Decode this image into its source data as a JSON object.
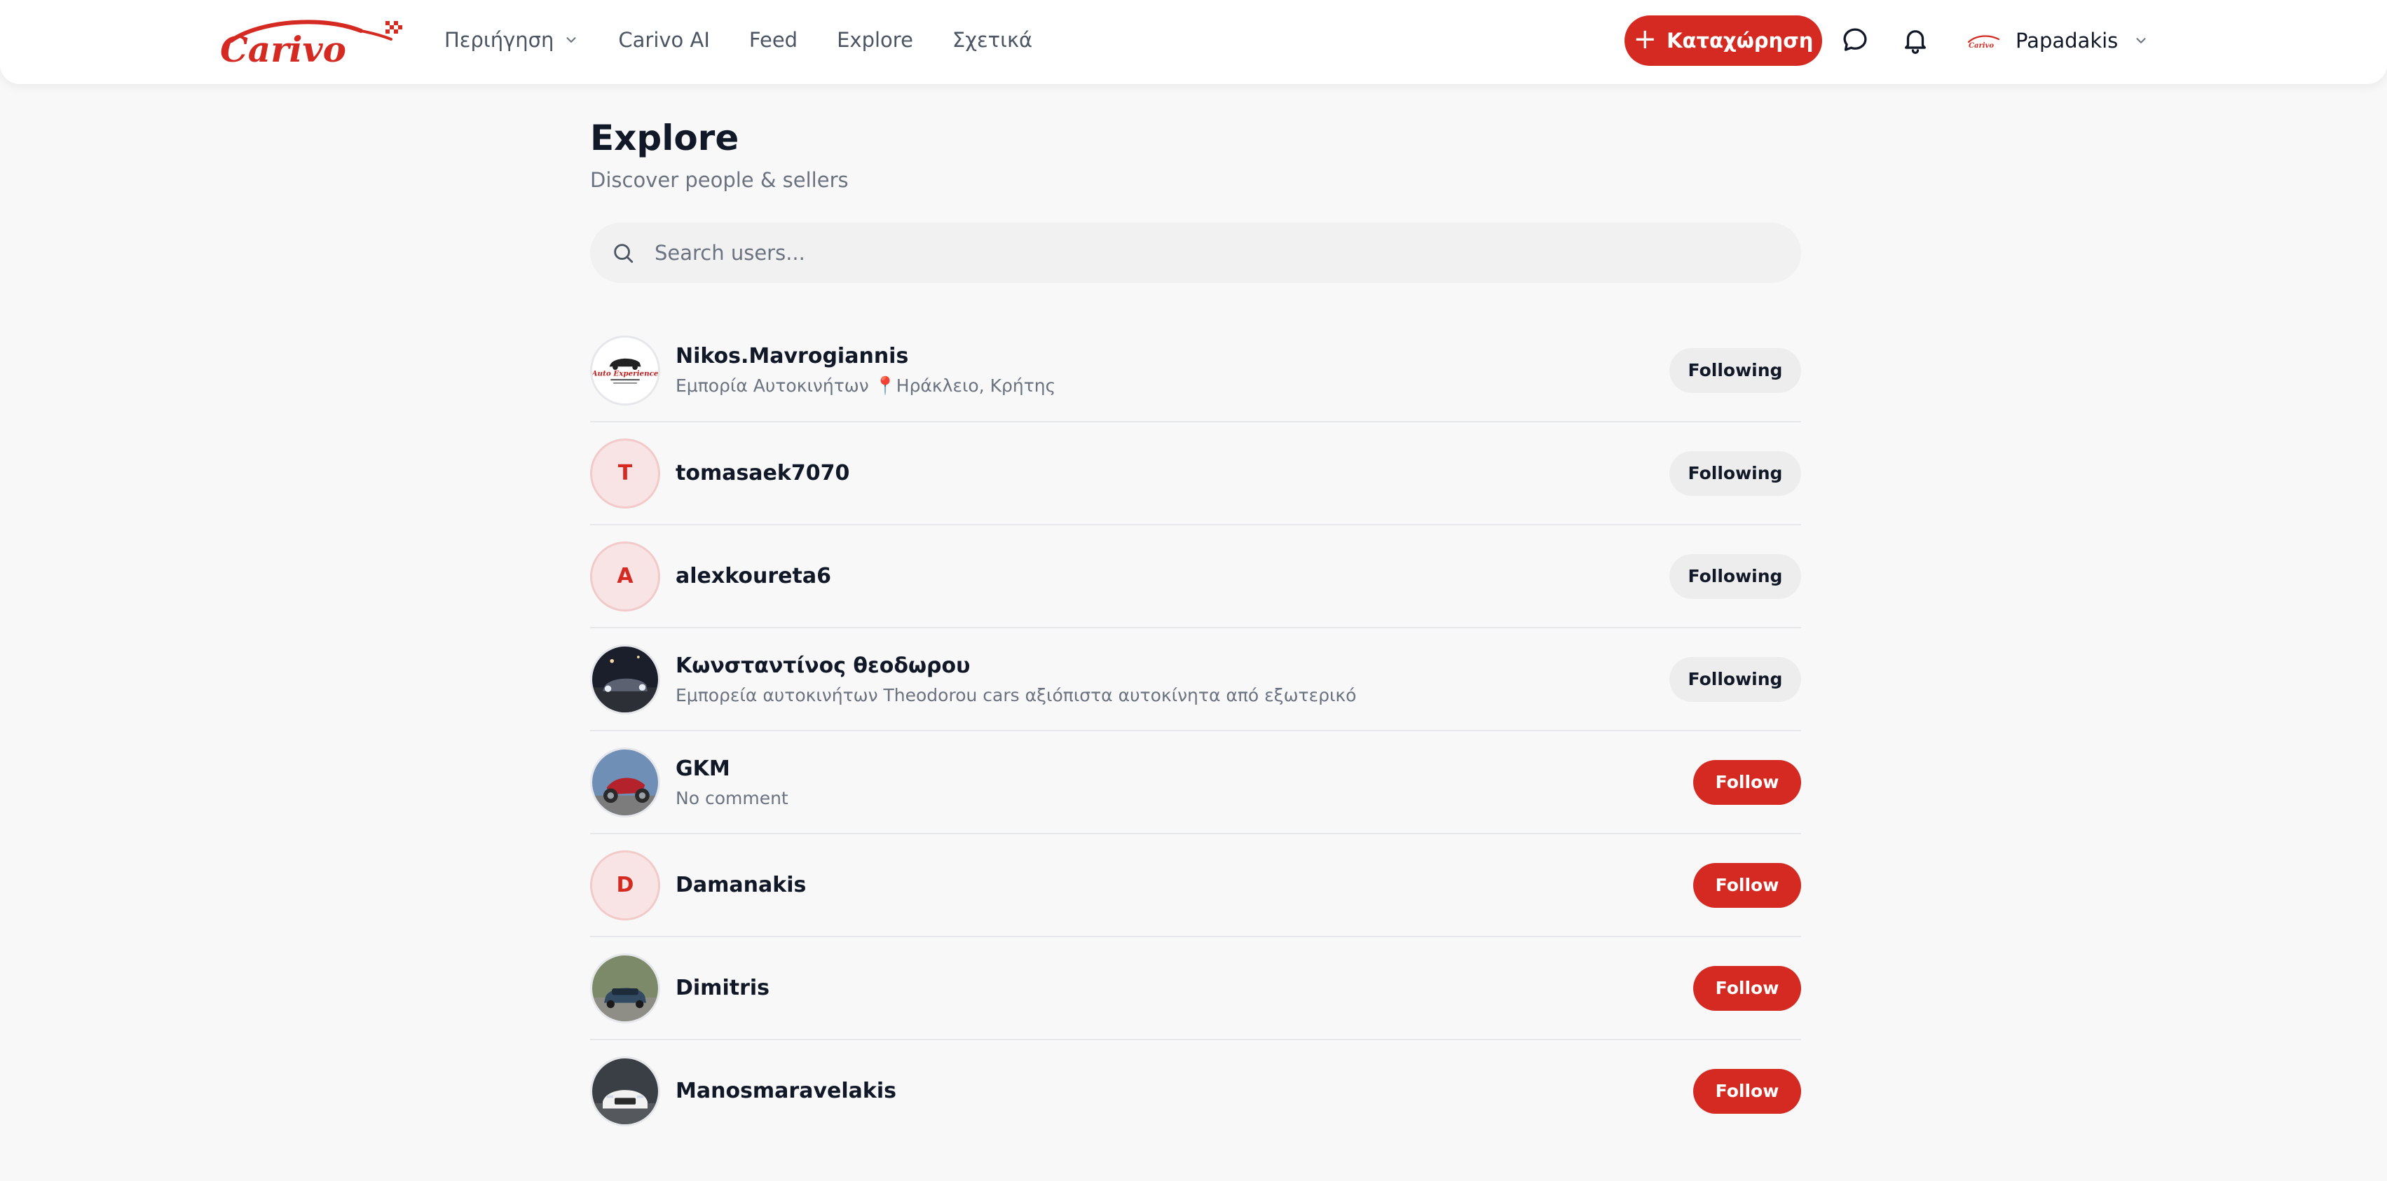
{
  "brand": {
    "logo_text": "Carivo",
    "accent": "#d42a22"
  },
  "nav": {
    "items": [
      {
        "label": "Περιήγηση",
        "dropdown": true
      },
      {
        "label": "Carivo AI"
      },
      {
        "label": "Feed"
      },
      {
        "label": "Explore"
      },
      {
        "label": "Σχετικά"
      }
    ]
  },
  "header": {
    "listing_button": "Καταχώρηση",
    "listing_icon": "plus-icon",
    "messages_icon": "chat-bubble-icon",
    "notifications_icon": "bell-icon",
    "user_name": "Papadakis"
  },
  "page": {
    "title": "Explore",
    "subtitle": "Discover people & sellers"
  },
  "search": {
    "placeholder": "Search users...",
    "value": ""
  },
  "users": [
    {
      "name": "Nikos.Mavrogiannis",
      "bio": "Εμπορία Αυτοκινήτων",
      "location": "Ηράκλειο, Κρήτης",
      "avatar": "photo",
      "avatar_text": "Auto Experience",
      "action": "Following"
    },
    {
      "name": "tomasaek7070",
      "bio": "",
      "avatar": "letter",
      "initial": "T",
      "action": "Following"
    },
    {
      "name": "alexkoureta6",
      "bio": "",
      "avatar": "letter",
      "initial": "A",
      "action": "Following"
    },
    {
      "name": "Κωνσταντίνος θεοδωρου",
      "bio": "Εμπορεία αυτοκινήτων Theodorou cars αξιόπιστα αυτοκίνητα από εξωτερικό",
      "avatar": "photo",
      "action": "Following"
    },
    {
      "name": "GKM",
      "bio": "No comment",
      "avatar": "photo",
      "action": "Follow"
    },
    {
      "name": "Damanakis",
      "bio": "",
      "avatar": "letter",
      "initial": "D",
      "action": "Follow"
    },
    {
      "name": "Dimitris",
      "bio": "",
      "avatar": "photo",
      "action": "Follow"
    },
    {
      "name": "Manosmaravelakis",
      "bio": "",
      "avatar": "photo",
      "action": "Follow"
    }
  ]
}
